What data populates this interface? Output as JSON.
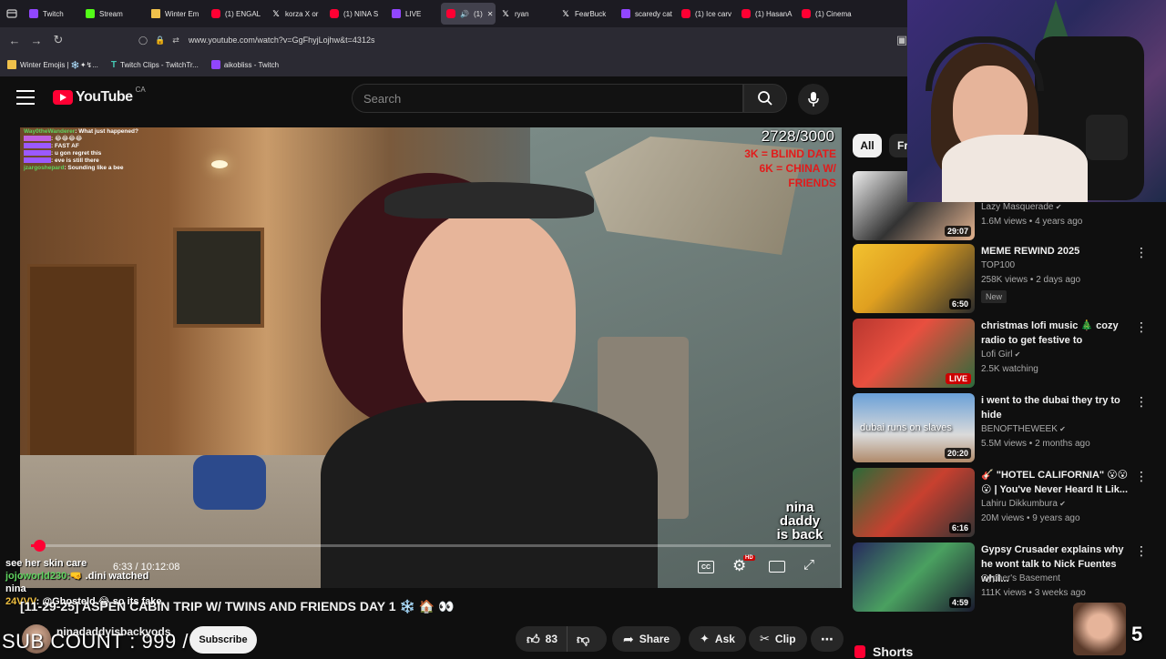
{
  "browser": {
    "tabs": [
      {
        "label": "Twitch",
        "icon": "twitch-icon"
      },
      {
        "label": "Stream",
        "icon": "kick-icon"
      },
      {
        "label": "Winter Em",
        "icon": "folder-icon"
      },
      {
        "label": "(1) ENGAL",
        "icon": "youtube-icon"
      },
      {
        "label": "korza X or",
        "icon": "x-icon"
      },
      {
        "label": "(1) NINA S",
        "icon": "youtube-icon"
      },
      {
        "label": "LIVE",
        "icon": "twitch-icon"
      },
      {
        "label": "(1)",
        "icon": "youtube-icon"
      },
      {
        "label": "ryan",
        "icon": "x-icon"
      },
      {
        "label": "FearBuck",
        "icon": "x-icon"
      },
      {
        "label": "scaredy cat",
        "icon": "twitch-icon"
      },
      {
        "label": "(1) Ice carv",
        "icon": "youtube-icon"
      },
      {
        "label": "(1) HasanA",
        "icon": "youtube-icon"
      },
      {
        "label": "(1) Cinema",
        "icon": "youtube-icon"
      }
    ],
    "url": "www.youtube.com/watch?v=GgFhyjLojhw&t=4312s",
    "bookmarks": [
      "Winter Emojis | ❄️✦↯...",
      "Twitch Clips - TwitchTr...",
      "aikobliss - Twitch"
    ]
  },
  "youtube": {
    "logo": "YouTube",
    "country": "CA",
    "search_placeholder": "Search"
  },
  "player": {
    "goal_count": "2728/3000",
    "goal_lines": [
      "3K = BLIND DATE",
      "6K = CHINA W/",
      "FRIENDS"
    ],
    "chat": [
      {
        "user": "Way0theWanderer",
        "msg": "What just happened?",
        "color": "#5fd35f"
      },
      {
        "user": "",
        "msg": "😂😂😂😂",
        "color": "#c05fe0"
      },
      {
        "user": "",
        "msg": "FAST AF",
        "color": "#9b59ff"
      },
      {
        "user": "",
        "msg": "u gon regret this",
        "color": "#9b59ff"
      },
      {
        "user": "",
        "msg": "eve is still there",
        "color": "#9b59ff"
      },
      {
        "user": "jzargoshepard",
        "msg": "Sounding like a bee",
        "color": "#5fd35f"
      }
    ],
    "time": "6:33 / 10:12:08",
    "progress": 0.0107,
    "watermark": [
      "nina",
      "daddy",
      "is back"
    ]
  },
  "overlay_chat": [
    {
      "user": "",
      "msg": "see her skin care"
    },
    {
      "user": "jojoworld230:",
      "msg": "🤜 .dini watched"
    },
    {
      "user": "",
      "msg": "nina"
    },
    {
      "user": "24VVV",
      "msg": ": @Ghosteld 😂 so its fake"
    }
  ],
  "video": {
    "title": "[11-29-25] ASPEN CABIN TRIP W/ TWINS AND FRIENDS DAY 1 ❄️ 🏠 👀",
    "channel": "ninadaddyisbackyods",
    "subscribe": "Subscribe",
    "sub_count": "SUB COUNT : 999 /",
    "likes": "83",
    "actions": [
      "Share",
      "Ask",
      "Clip"
    ],
    "sub_goal_number": "5"
  },
  "sidebar": {
    "chips": [
      "All",
      "Fr"
    ],
    "recs": [
      {
        "title": "",
        "channel": "Lazy Masquerade",
        "meta": "1.6M views • 4 years ago",
        "duration": "29:07",
        "verified": true
      },
      {
        "title": "MEME REWIND 2025",
        "channel": "TOP100",
        "meta": "258K views • 2 days ago",
        "duration": "6:50",
        "badge": "New"
      },
      {
        "title": "christmas lofi music 🎄 cozy radio to get festive to",
        "channel": "Lofi Girl",
        "meta": "2.5K watching",
        "live": "LIVE",
        "verified": true
      },
      {
        "title": "i went to the dubai they try to hide",
        "channel": "BENOFTHEWEEK",
        "meta": "5.5M views • 2 months ago",
        "duration": "20:20",
        "thumb_text": "dubai runs on slaves",
        "verified": true
      },
      {
        "title": "🎸 \"HOTEL CALIFORNIA\" 😮😮 😮 | You've Never Heard It Lik...",
        "channel": "Lahiru Dikkumbura",
        "meta": "20M views • 9 years ago",
        "duration": "6:16",
        "verified": true
      },
      {
        "title": "Gypsy Crusader explains why he wont talk to Nick Fuentes whil...",
        "channel": "Cypher's Basement",
        "meta": "111K views • 3 weeks ago",
        "duration": "4:59"
      }
    ],
    "shorts_label": "Shorts"
  }
}
